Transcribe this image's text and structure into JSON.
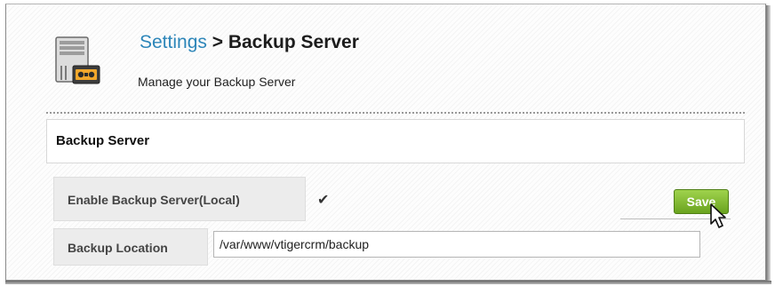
{
  "header": {
    "settings_link": "Settings",
    "title_separator": " > ",
    "title": "Backup Server",
    "subtitle": "Manage your Backup Server",
    "icon": "server-backup-icon"
  },
  "section": {
    "title": "Backup Server"
  },
  "form": {
    "enable_label": "Enable Backup Server(Local)",
    "enable_checked": true,
    "check_glyph": "✔",
    "save_label": "Save",
    "location_label": "Backup Location",
    "location_value": "/var/www/vtigercrm/backup"
  },
  "colors": {
    "link": "#2d86b9",
    "save_button": "#82bb34",
    "label_bg": "#ececec"
  }
}
